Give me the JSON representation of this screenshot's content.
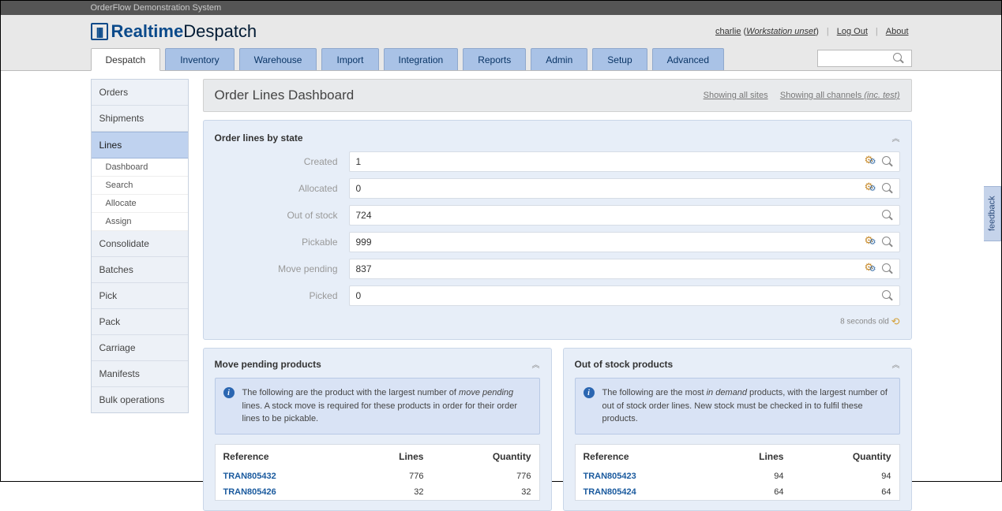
{
  "system_title": "OrderFlow Demonstration System",
  "logo_realtime": "Realtime",
  "logo_despatch": "Despatch",
  "user": {
    "name": "charlie",
    "workstation": "Workstation unset",
    "logout": "Log Out",
    "about": "About"
  },
  "tabs": [
    "Despatch",
    "Inventory",
    "Warehouse",
    "Import",
    "Integration",
    "Reports",
    "Admin",
    "Setup",
    "Advanced"
  ],
  "sidenav": {
    "items": [
      "Orders",
      "Shipments",
      "Lines",
      "Consolidate",
      "Batches",
      "Pick",
      "Pack",
      "Carriage",
      "Manifests",
      "Bulk operations"
    ],
    "lines_sub": [
      "Dashboard",
      "Search",
      "Allocate",
      "Assign"
    ]
  },
  "page_title": "Order Lines Dashboard",
  "filters": {
    "sites": "Showing all sites",
    "channels_pre": "Showing all channels ",
    "channels_suf": "(inc. test)"
  },
  "states_panel": {
    "title": "Order lines by state",
    "rows": [
      {
        "label": "Created",
        "value": "1",
        "gear": true
      },
      {
        "label": "Allocated",
        "value": "0",
        "gear": true
      },
      {
        "label": "Out of stock",
        "value": "724",
        "gear": false
      },
      {
        "label": "Pickable",
        "value": "999",
        "gear": true
      },
      {
        "label": "Move pending",
        "value": "837",
        "gear": true
      },
      {
        "label": "Picked",
        "value": "0",
        "gear": false
      }
    ],
    "footer": "8 seconds old"
  },
  "move_pending": {
    "title": "Move pending products",
    "info_pre": "The following are the product with the largest number of ",
    "info_em": "move pending",
    "info_post": " lines. A stock move is required for these products in order for their order lines to be pickable.",
    "headers": [
      "Reference",
      "Lines",
      "Quantity"
    ],
    "rows": [
      {
        "ref": "TRAN805432",
        "lines": "776",
        "qty": "776"
      },
      {
        "ref": "TRAN805426",
        "lines": "32",
        "qty": "32"
      }
    ]
  },
  "out_of_stock": {
    "title": "Out of stock products",
    "info_pre": "The following are the most ",
    "info_em": "in demand",
    "info_post": " products, with the largest number of out of stock order lines. New stock must be checked in to fulfil these products.",
    "headers": [
      "Reference",
      "Lines",
      "Quantity"
    ],
    "rows": [
      {
        "ref": "TRAN805423",
        "lines": "94",
        "qty": "94"
      },
      {
        "ref": "TRAN805424",
        "lines": "64",
        "qty": "64"
      }
    ]
  },
  "feedback": "feedback"
}
